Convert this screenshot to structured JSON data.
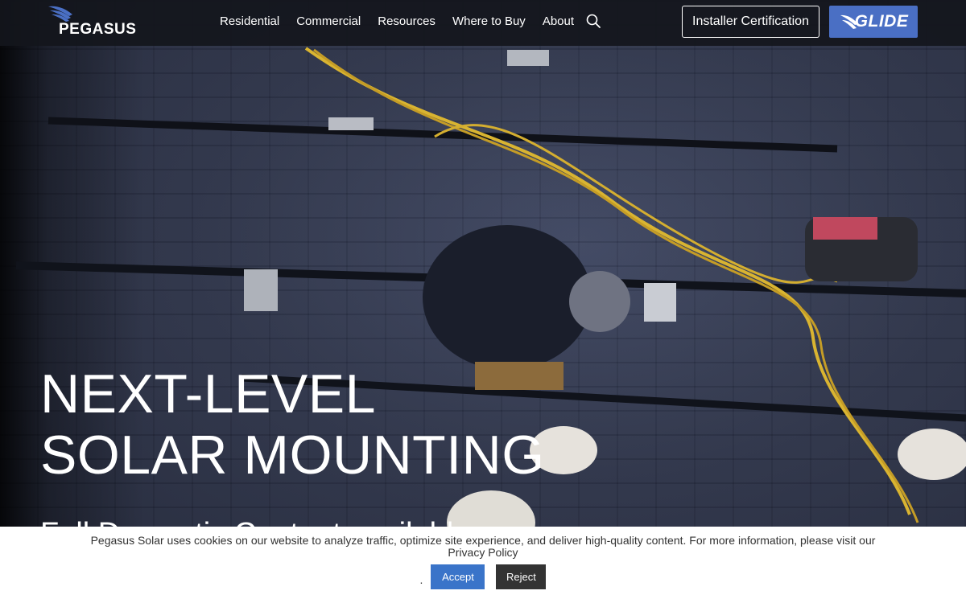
{
  "brand": {
    "name": "PEGASUS",
    "accent": "#4a6fc4"
  },
  "nav": {
    "items": [
      {
        "label": "Residential"
      },
      {
        "label": "Commercial"
      },
      {
        "label": "Resources"
      },
      {
        "label": "Where to Buy"
      },
      {
        "label": "About"
      }
    ],
    "search_icon": "search-icon",
    "cert_button": "Installer Certification",
    "glide_button": "GLIDE"
  },
  "hero": {
    "headline_line1": "NEXT-LEVEL",
    "headline_line2": "SOLAR MOUNTING",
    "subhead": "Full Domestic Content available"
  },
  "cookie": {
    "text": "Pegasus Solar uses cookies on our website to analyze traffic, optimize site experience, and deliver high-quality content. For more information, please visit our",
    "link": "Privacy Policy",
    "dot": ".",
    "accept": "Accept",
    "reject": "Reject",
    "accept_color": "#3a74c9",
    "reject_color": "#333333"
  }
}
